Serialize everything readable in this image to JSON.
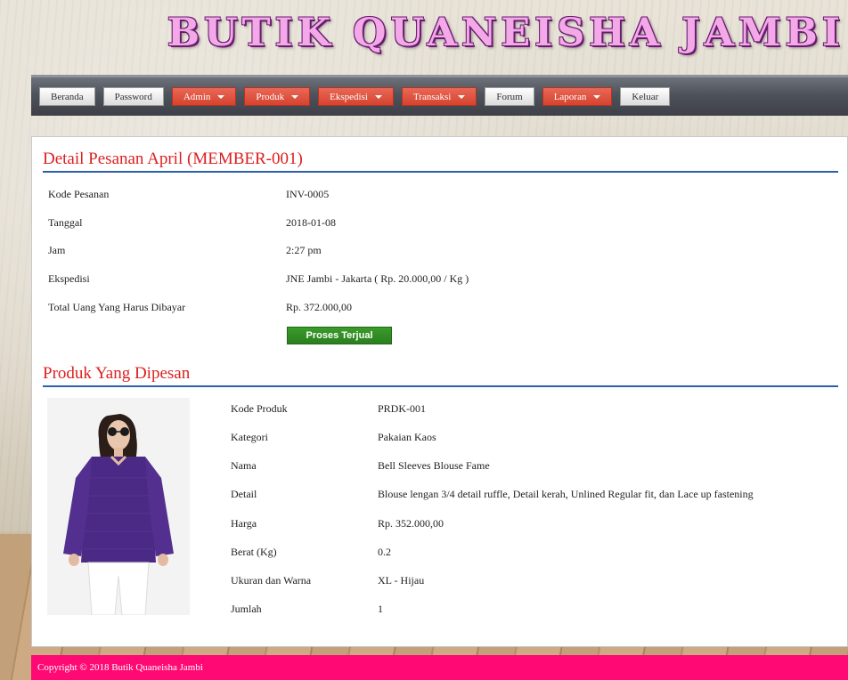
{
  "header": {
    "site_title": "BUTIK QUANEISHA JAMBI"
  },
  "nav": {
    "items": [
      {
        "label": "Beranda",
        "dropdown": false
      },
      {
        "label": "Password",
        "dropdown": false
      },
      {
        "label": "Admin",
        "dropdown": true
      },
      {
        "label": "Produk",
        "dropdown": true
      },
      {
        "label": "Ekspedisi",
        "dropdown": true
      },
      {
        "label": "Transaksi",
        "dropdown": true
      },
      {
        "label": "Forum",
        "dropdown": false
      },
      {
        "label": "Laporan",
        "dropdown": true
      },
      {
        "label": "Keluar",
        "dropdown": false
      }
    ]
  },
  "order": {
    "title": "Detail Pesanan April (MEMBER-001)",
    "fields": [
      {
        "label": "Kode Pesanan",
        "value": "INV-0005"
      },
      {
        "label": "Tanggal",
        "value": "2018-01-08"
      },
      {
        "label": "Jam",
        "value": "2:27 pm"
      },
      {
        "label": "Ekspedisi",
        "value": "JNE Jambi - Jakarta ( Rp. 20.000,00 / Kg )"
      },
      {
        "label": "Total Uang Yang Harus Dibayar",
        "value": "Rp. 372.000,00"
      }
    ],
    "action_label": "Proses Terjual"
  },
  "products": {
    "title": "Produk Yang Dipesan",
    "fields": [
      {
        "label": "Kode Produk",
        "value": "PRDK-001"
      },
      {
        "label": "Kategori",
        "value": "Pakaian Kaos"
      },
      {
        "label": "Nama",
        "value": "Bell Sleeves Blouse Fame"
      },
      {
        "label": "Detail",
        "value": "Blouse lengan 3/4 detail ruffle, Detail kerah, Unlined Regular fit, dan Lace up fastening"
      },
      {
        "label": "Harga",
        "value": "Rp. 352.000,00"
      },
      {
        "label": "Berat (Kg)",
        "value": "0.2"
      },
      {
        "label": "Ukuran dan Warna",
        "value": "XL - Hijau"
      },
      {
        "label": "Jumlah",
        "value": "1"
      }
    ]
  },
  "footer": {
    "copyright": "Copyright © 2018 Butik Quaneisha Jambi"
  },
  "colors": {
    "nav_red": "#d4432f",
    "title_red": "#dd1f1f",
    "rule_blue": "#2d5fa8",
    "button_green": "#2a7f1e",
    "footer_pink": "#ff0a74",
    "title_pink": "#f3a8e8"
  }
}
